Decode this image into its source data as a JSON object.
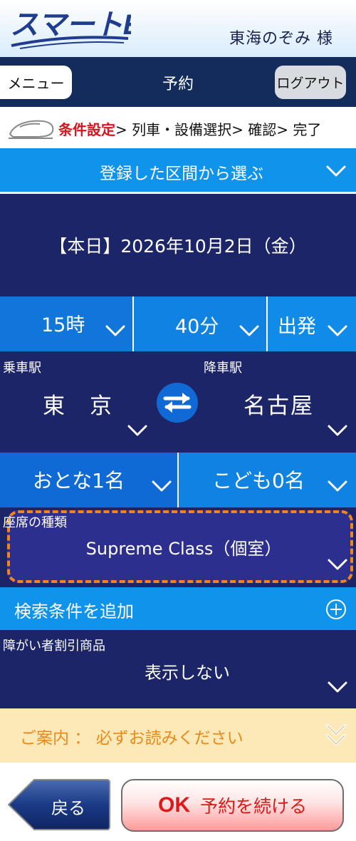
{
  "header": {
    "logo_text": "スマートEX",
    "user_name": "東海のぞみ 様"
  },
  "nav": {
    "menu_label": "メニュー",
    "title": "予約",
    "logout_label": "ログアウト"
  },
  "steps": {
    "current": "条件設定",
    "rest": "> 列車・設備選択> 確認> 完了"
  },
  "saved_routes": {
    "label": "登録した区間から選ぶ"
  },
  "date": {
    "label": "【本日】2026年10月2日（金）"
  },
  "time": {
    "hour": "15時",
    "minute": "40分",
    "mode": "出発"
  },
  "stations": {
    "from_label": "乗車駅",
    "from_value": "東　京",
    "to_label": "降車駅",
    "to_value": "名古屋"
  },
  "passengers": {
    "adult": "おとな1名",
    "child": "こども0名"
  },
  "seat": {
    "label": "座席の種類",
    "value": "Supreme Class（個室）"
  },
  "search_add": {
    "label": "検索条件を追加"
  },
  "discount": {
    "label": "障がい者割引商品",
    "value": "表示しない"
  },
  "info": {
    "label": "ご案内 ： 必ずお読みください"
  },
  "footer": {
    "back_label": "戻る",
    "ok_strong": "OK",
    "ok_label": "予約を続ける"
  },
  "colors": {
    "navy": "#1c2567",
    "navbar": "#132c5c",
    "blue": "#1093ea",
    "highlight_border": "#f3841c",
    "accent_red": "#e01818"
  }
}
